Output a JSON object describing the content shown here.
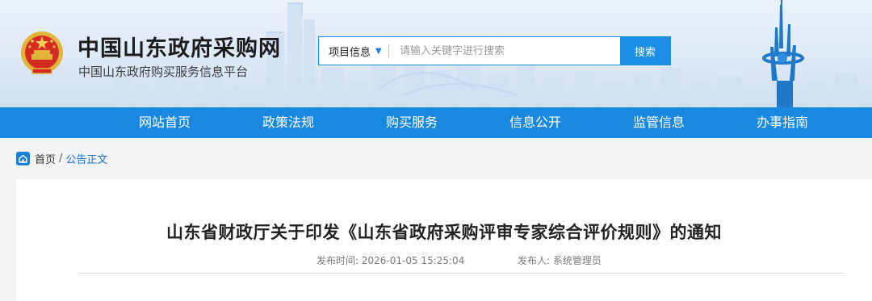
{
  "header": {
    "site_title": "中国山东政府采购网",
    "site_subtitle": "中国山东政府购买服务信息平台",
    "search": {
      "category": "项目信息",
      "placeholder": "请输入关键字进行搜索",
      "button": "搜索"
    }
  },
  "nav": {
    "items": [
      "网站首页",
      "政策法规",
      "购买服务",
      "信息公开",
      "监管信息",
      "办事指南"
    ]
  },
  "breadcrumb": {
    "home": "首页",
    "separator": "/",
    "current": "公告正文"
  },
  "article": {
    "title": "山东省财政厅关于印发《山东省政府采购评审专家综合评价规则》的通知",
    "publish_label": "发布时间:",
    "publish_time": "2026-01-05 15:25:04",
    "publisher_label": "发布人:",
    "publisher": "系统管理员"
  },
  "icons": {
    "emblem": "national-emblem-icon",
    "home": "home-icon",
    "caret": "caret-down-icon",
    "tower": "landmark-tower-icon"
  },
  "colors": {
    "primary": "#1888e0",
    "link": "#1a6fc7",
    "title": "#222222"
  }
}
